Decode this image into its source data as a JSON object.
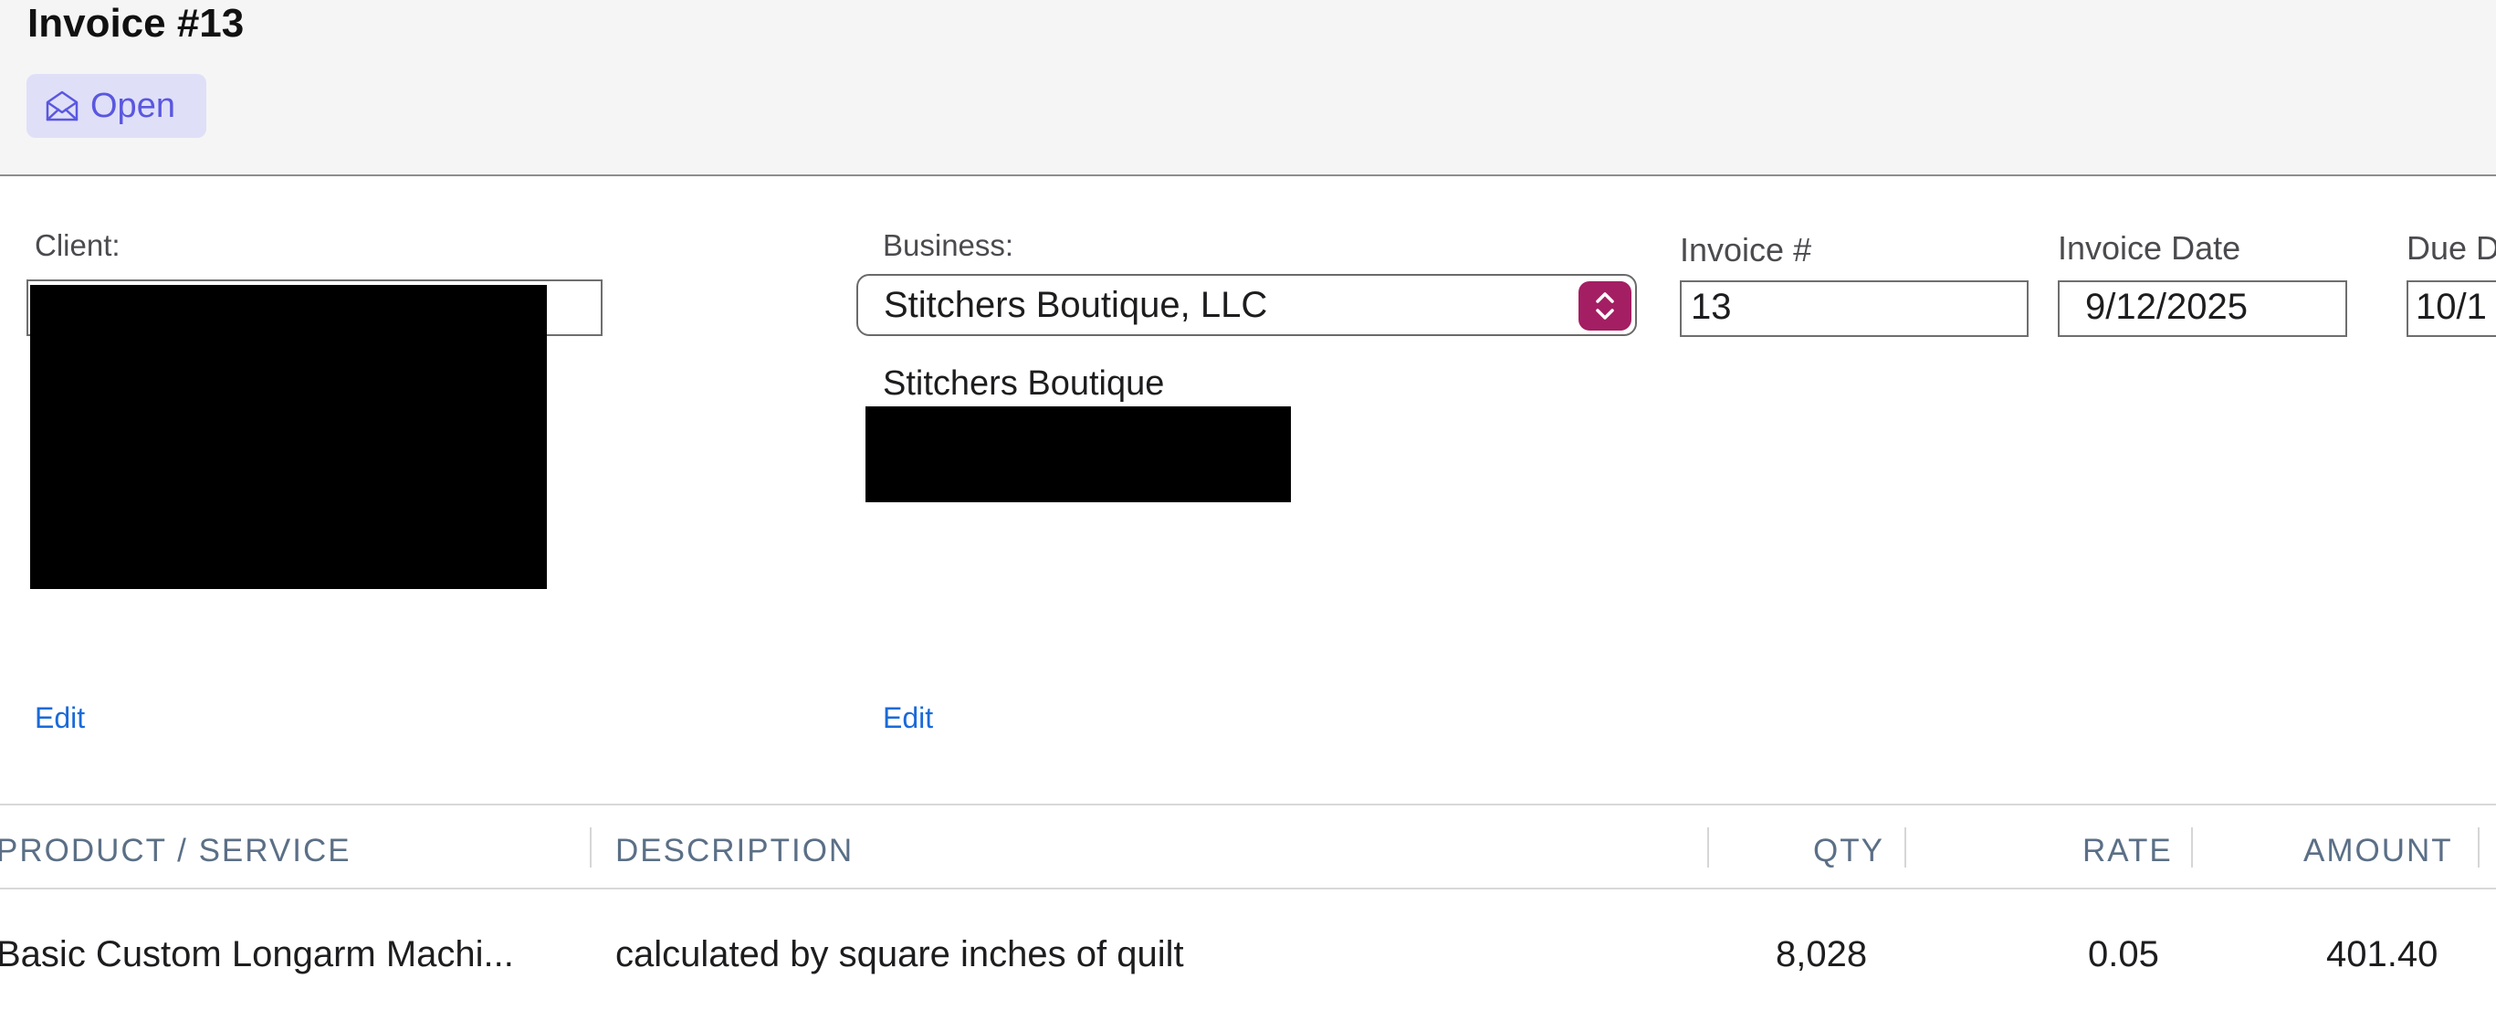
{
  "header": {
    "title": "Invoice #13",
    "status": {
      "label": "Open",
      "icon": "envelope-open-icon",
      "color": "#5a57e0",
      "background": "#dfdff8"
    }
  },
  "client": {
    "label": "Client:",
    "edit_label": "Edit"
  },
  "business": {
    "label": "Business:",
    "selected": "Stitchers Boutique, LLC",
    "name": "Stitchers Boutique",
    "edit_label": "Edit",
    "stepper_icon": "chevron-up-down-icon",
    "stepper_color": "#a41e63"
  },
  "invoice_number": {
    "label": "Invoice #",
    "value": "13"
  },
  "invoice_date": {
    "label": "Invoice Date",
    "value": "9/12/2025"
  },
  "due_date": {
    "label": "Due D",
    "value": "10/1"
  },
  "table": {
    "columns": [
      "PRODUCT / SERVICE",
      "DESCRIPTION",
      "QTY",
      "RATE",
      "AMOUNT"
    ],
    "rows": [
      {
        "product": "Basic Custom Longarm Machi...",
        "description": "calculated by square inches of quilt",
        "qty": "8,028",
        "rate": "0.05",
        "amount": "401.40"
      }
    ]
  },
  "colors": {
    "link": "#1a6ad8",
    "header_background": "#f5f5f5",
    "column_header_text": "#5b6f86"
  }
}
